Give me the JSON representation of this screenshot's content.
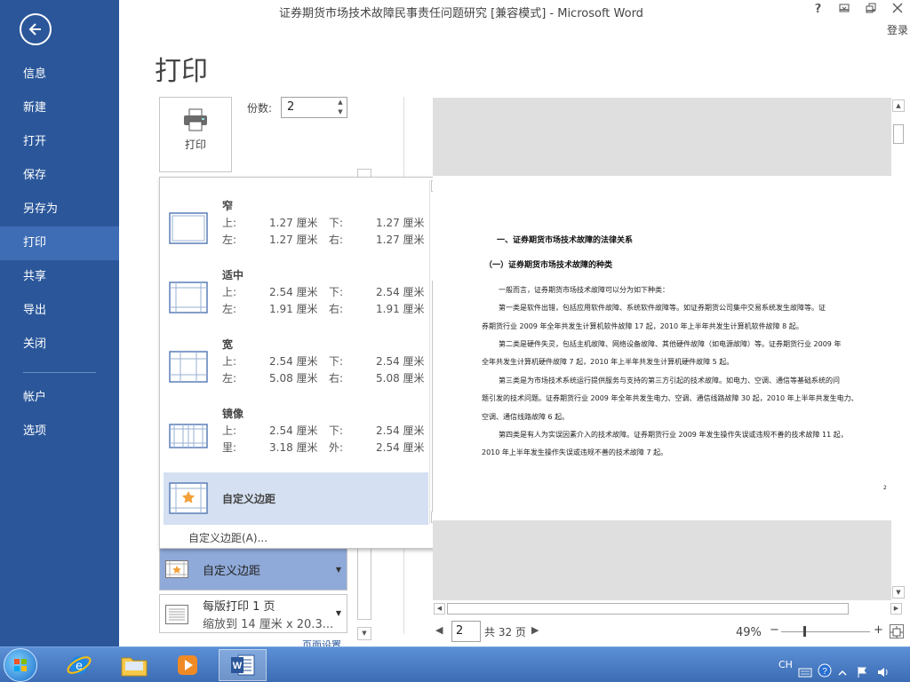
{
  "window": {
    "title": "证券期货市场技术故障民事责任问题研究 [兼容模式] - Microsoft Word",
    "help": "?",
    "login": "登录"
  },
  "sidebar": {
    "items": [
      {
        "label": "信息"
      },
      {
        "label": "新建"
      },
      {
        "label": "打开"
      },
      {
        "label": "保存"
      },
      {
        "label": "另存为"
      },
      {
        "label": "打印"
      },
      {
        "label": "共享"
      },
      {
        "label": "导出"
      },
      {
        "label": "关闭"
      },
      {
        "label": "帐户"
      },
      {
        "label": "选项"
      }
    ],
    "active": "打印"
  },
  "print": {
    "heading": "打印",
    "button_label": "打印",
    "copies_label": "份数:",
    "copies_value": "2"
  },
  "margins_dropdown": {
    "options": [
      {
        "name": "窄",
        "r1a": "上:",
        "r1b": "1.27 厘米",
        "r1c": "下:",
        "r1d": "1.27 厘米",
        "r2a": "左:",
        "r2b": "1.27 厘米",
        "r2c": "右:",
        "r2d": "1.27 厘米"
      },
      {
        "name": "适中",
        "r1a": "上:",
        "r1b": "2.54 厘米",
        "r1c": "下:",
        "r1d": "2.54 厘米",
        "r2a": "左:",
        "r2b": "1.91 厘米",
        "r2c": "右:",
        "r2d": "1.91 厘米"
      },
      {
        "name": "宽",
        "r1a": "上:",
        "r1b": "2.54 厘米",
        "r1c": "下:",
        "r1d": "2.54 厘米",
        "r2a": "左:",
        "r2b": "5.08 厘米",
        "r2c": "右:",
        "r2d": "5.08 厘米"
      },
      {
        "name": "镜像",
        "r1a": "上:",
        "r1b": "2.54 厘米",
        "r1c": "下:",
        "r1d": "2.54 厘米",
        "r2a": "里:",
        "r2b": "3.18 厘米",
        "r2c": "外:",
        "r2d": "2.54 厘米"
      }
    ],
    "custom_option": "自定义边距",
    "custom_link": "自定义边距(A)..."
  },
  "settings": {
    "margin_select": "自定义边距",
    "pages_per_sheet": "每版打印 1 页",
    "scale_to": "缩放到 14 厘米 x 20.3...",
    "page_setup": "页面设置"
  },
  "document": {
    "heading1": "一、证券期货市场技术故障的法律关系",
    "heading2": "（一）证券期货市场技术故障的种类",
    "lines": [
      "一般而言，证券期货市场技术故障可以分为如下种类：",
      "第一类是软件出错，包括应用软件故障、系统软件故障等。如证券期货公司集中交易系统发生故障等。证",
      "券期货行业 2009 年全年共发生计算机软件故障 17 起，2010 年上半年共发生计算机软件故障 8 起。",
      "第二类是硬件失灵，包括主机故障、网络设备故障、其他硬件故障（如电源故障）等。证券期货行业 2009 年",
      "全年共发生计算机硬件故障 7 起，2010 年上半年共发生计算机硬件故障 5 起。",
      "第三类是为市场技术系统运行提供服务与支持的第三方引起的技术故障。如电力、空调、通信等基础系统的问",
      "题引发的技术问题。证券期货行业 2009 年全年共发生电力、空调、通信线路故障 30 起，2010 年上半年共发生电力、",
      "空调、通信线路故障 6 起。",
      "第四类是有人为实误因素介入的技术故障。证券期货行业 2009 年发生操作失误或违规不善的技术故障 11 起，",
      "2010 年上半年发生操作失误或违规不善的技术故障 7 起。"
    ],
    "page_marker": "2"
  },
  "pager": {
    "current": "2",
    "total": "共 32 页"
  },
  "zoom": {
    "level": "49%",
    "minus": "−",
    "plus": "+"
  },
  "taskbar": {
    "tray_lang": "CH"
  }
}
